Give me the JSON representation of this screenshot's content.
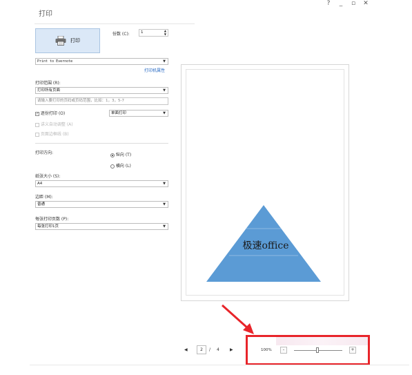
{
  "window": {
    "title": "打印",
    "help": "?",
    "minimize": "_",
    "maximize": "▫",
    "close": "✕"
  },
  "print_button": {
    "label": "打印"
  },
  "copies": {
    "label": "份数 (C):",
    "value": "1"
  },
  "printer": {
    "selected": "Print to Evernote",
    "properties_link": "打印机属性"
  },
  "range": {
    "label": "打印范围 (R):",
    "selected": "打印所有页面",
    "placeholder": "请输入要打印的页码或页码范围，比如：1，3，5-7"
  },
  "collate": {
    "label": "逐份打印 (O)",
    "checked": true,
    "mode_selected": "单面打印"
  },
  "auto_fit": {
    "label": "讲义自动调整 (A)"
  },
  "border": {
    "label": "页面边框线 (B)"
  },
  "orientation": {
    "label": "打印方向:",
    "portrait": "纵向 (T)",
    "landscape": "横向 (L)"
  },
  "paper": {
    "label": "纸张大小 (S):",
    "selected": "A4"
  },
  "margin": {
    "label": "边距 (M):",
    "selected": "普通"
  },
  "pages_per_sheet": {
    "label": "每张打印页数 (P):",
    "selected": "每张打印1页"
  },
  "preview": {
    "slide_text": "极速office",
    "shape_color": "#5b9bd5"
  },
  "pager": {
    "prev": "◀",
    "current": "2",
    "separator": "/",
    "total": "4",
    "next": "▶"
  },
  "zoom": {
    "level": "100%",
    "minus": "-",
    "plus": "+",
    "level_fraction": 0.5
  },
  "annotation": {
    "color": "#e8242a"
  }
}
